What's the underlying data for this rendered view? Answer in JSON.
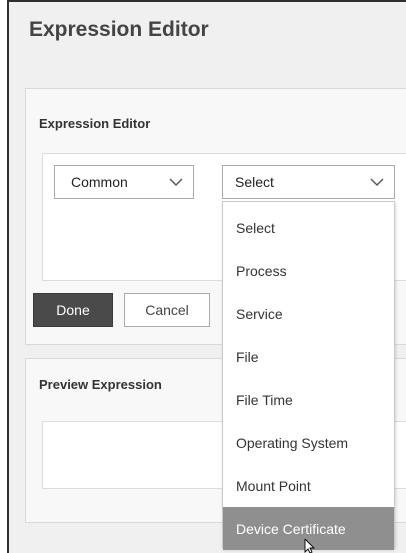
{
  "window_title": "Expression Editor",
  "editor_panel": {
    "label": "Expression Editor"
  },
  "common_select": {
    "value": "Common"
  },
  "main_select": {
    "value": "Select"
  },
  "buttons": {
    "done": "Done",
    "cancel": "Cancel"
  },
  "preview_panel": {
    "label": "Preview Expression"
  },
  "dropdown": {
    "items": [
      "Select",
      "Process",
      "Service",
      "File",
      "File Time",
      "Operating System",
      "Mount Point",
      "Device Certificate"
    ],
    "highlighted": "Device Certificate"
  },
  "colors": {
    "primary_button": "#4a4a4a",
    "highlight": "#8f8f8f"
  },
  "icons": [
    "chevron-down-icon",
    "pointer-cursor-icon"
  ]
}
